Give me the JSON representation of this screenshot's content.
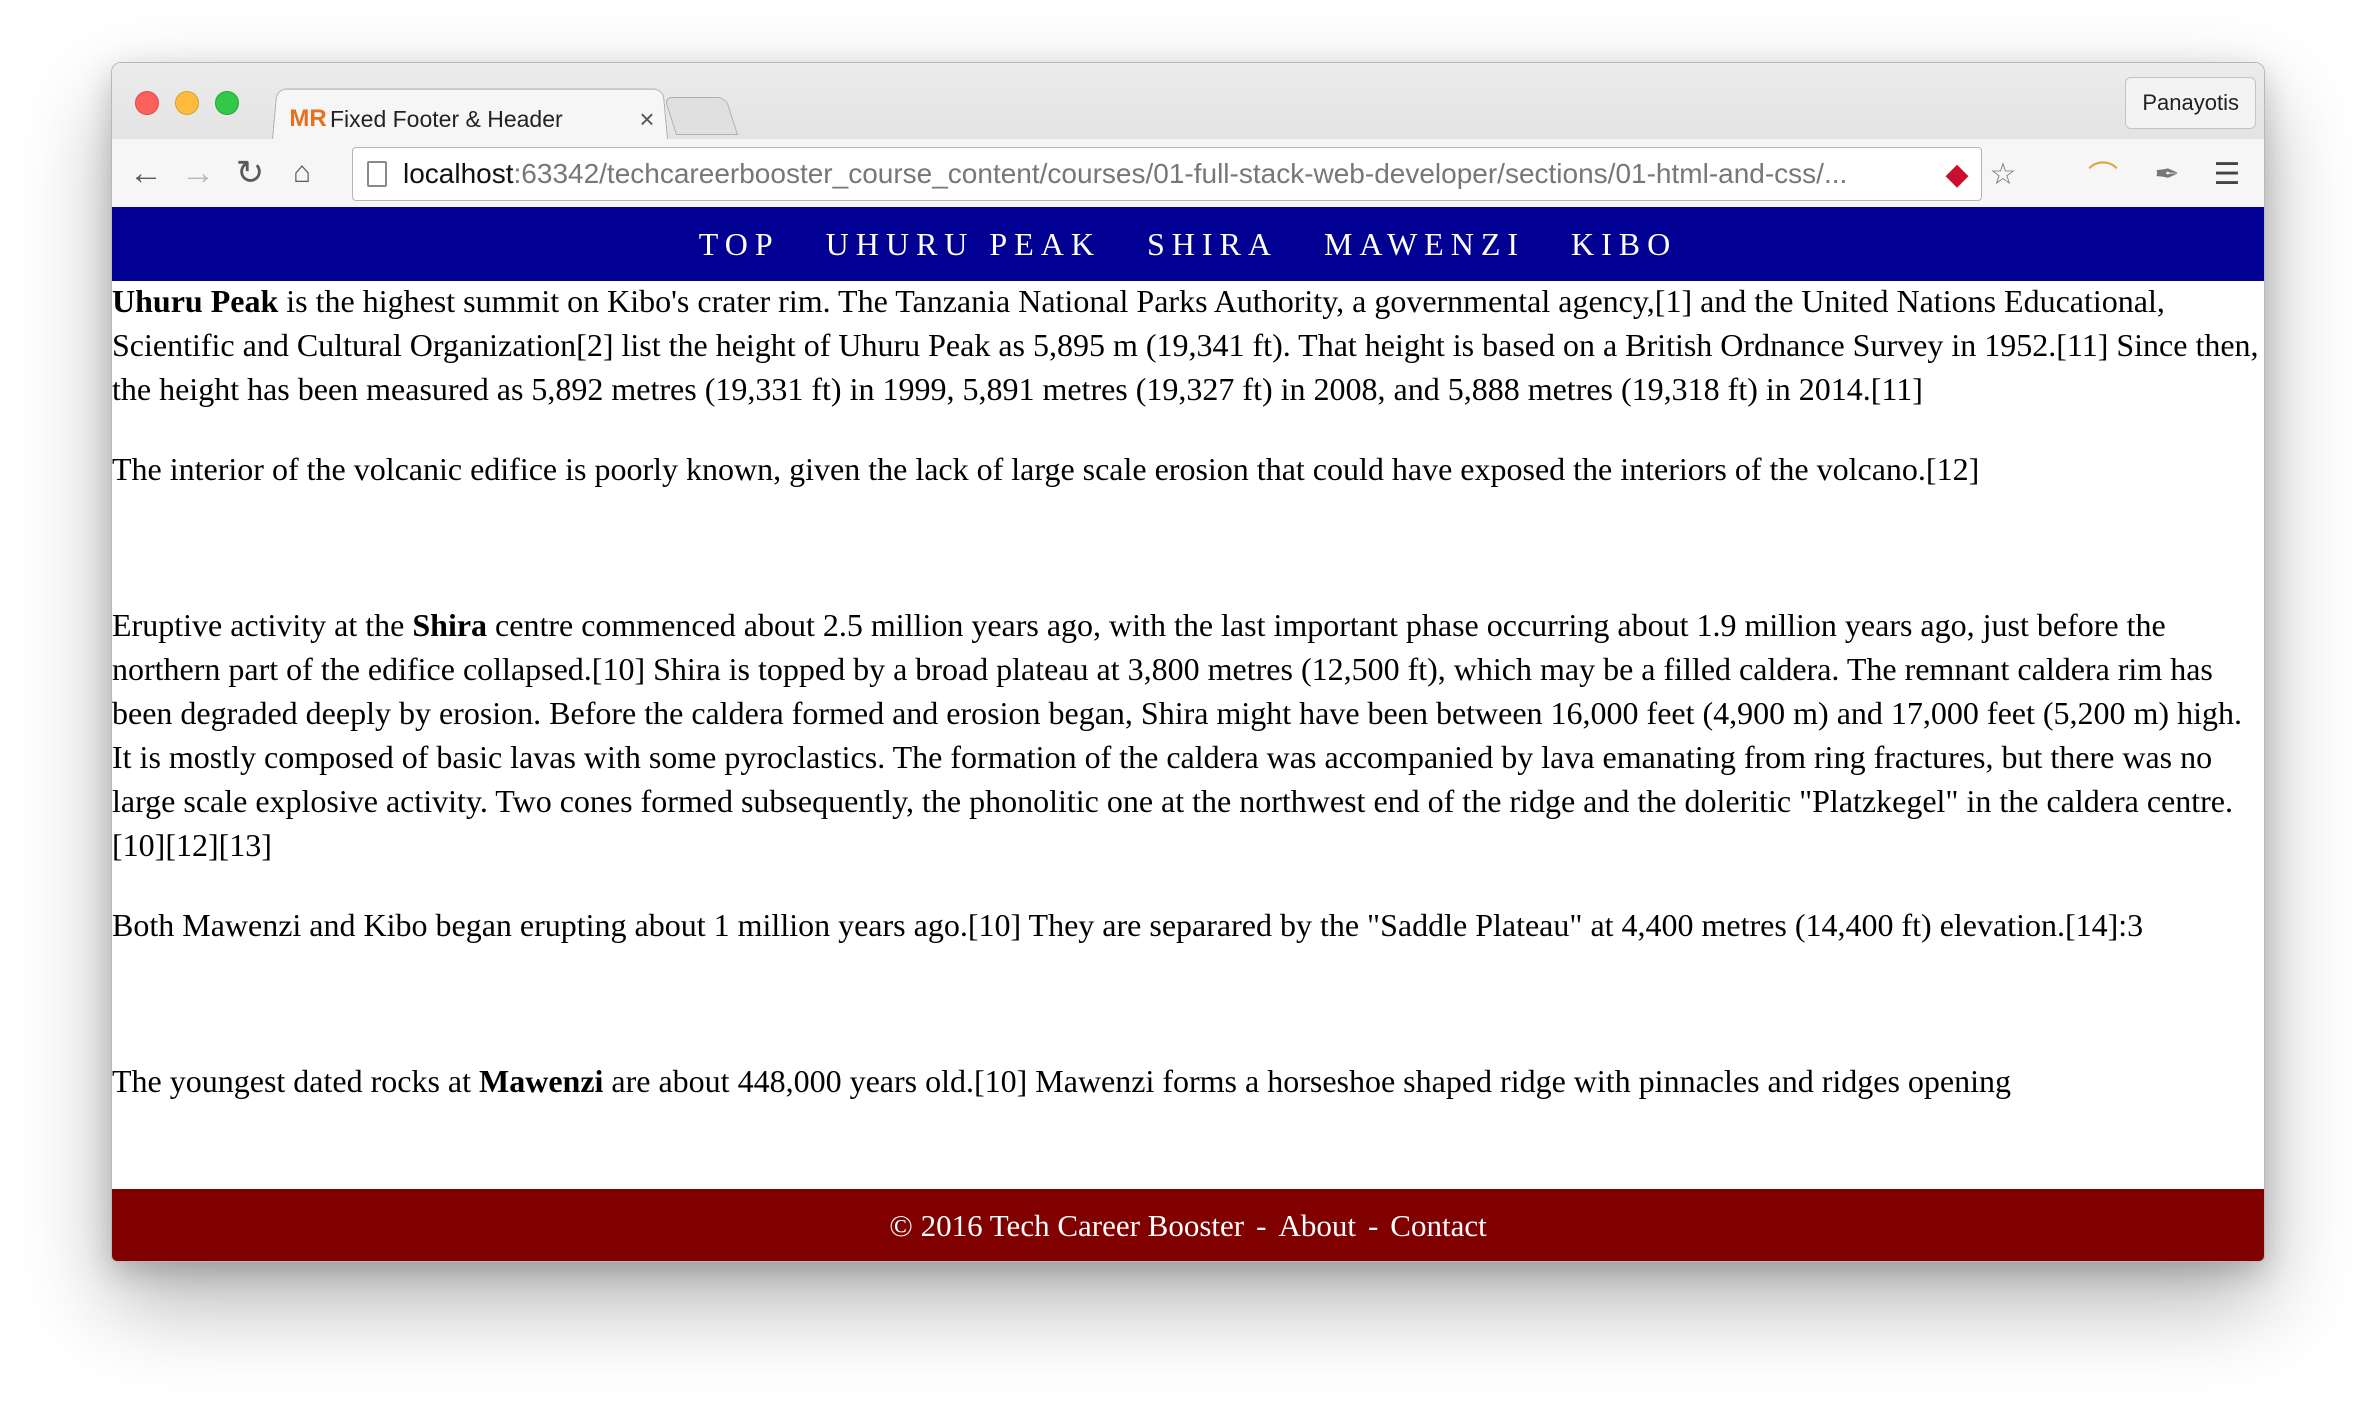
{
  "browser": {
    "tab_title": "Fixed Footer & Header",
    "tab_favicon": "MR",
    "tab_close": "×",
    "profile_name": "Panayotis",
    "url_host": "localhost",
    "url_rest": ":63342/techcareerbooster_course_content/courses/01-full-stack-web-developer/sections/01-html-and-css/...",
    "icons": {
      "back": "back-arrow-icon",
      "forward": "forward-arrow-icon",
      "reload": "reload-icon",
      "home": "home-icon",
      "page": "page-icon",
      "ruby": "ruby-extension-icon",
      "star": "bookmark-star-icon",
      "ext": "extension-icon",
      "tools": "developer-tools-icon",
      "menu": "hamburger-menu-icon"
    }
  },
  "header": {
    "links": [
      "TOP",
      "UHURU PEAK",
      "SHIRA",
      "MAWENZI",
      "KIBO"
    ]
  },
  "content": {
    "p1_bold": "Uhuru Peak",
    "p1_text": " is the highest summit on Kibo's crater rim. The Tanzania National Parks Authority, a governmental agency,[1] and the United Nations Educational, Scientific and Cultural Organization[2] list the height of Uhuru Peak as 5,895 m (19,341 ft). That height is based on a British Ordnance Survey in 1952.[11] Since then, the height has been measured as 5,892 metres (19,331 ft) in 1999, 5,891 metres (19,327 ft) in 2008, and 5,888 metres (19,318 ft) in 2014.[11]",
    "p2_text": "The interior of the volcanic edifice is poorly known, given the lack of large scale erosion that could have exposed the interiors of the volcano.[12]",
    "p3_pre": "Eruptive activity at the ",
    "p3_bold": "Shira",
    "p3_text": " centre commenced about 2.5 million years ago, with the last important phase occurring about 1.9 million years ago, just before the northern part of the edifice collapsed.[10] Shira is topped by a broad plateau at 3,800 metres (12,500 ft), which may be a filled caldera. The remnant caldera rim has been degraded deeply by erosion. Before the caldera formed and erosion began, Shira might have been between 16,000 feet (4,900 m) and 17,000 feet (5,200 m) high. It is mostly composed of basic lavas with some pyroclastics. The formation of the caldera was accompanied by lava emanating from ring fractures, but there was no large scale explosive activity. Two cones formed subsequently, the phonolitic one at the northwest end of the ridge and the doleritic \"Platzkegel\" in the caldera centre.[10][12][13]",
    "p4_text": "Both Mawenzi and Kibo began erupting about 1 million years ago.[10] They are separared by the \"Saddle Plateau\" at 4,400 metres (14,400 ft) elevation.[14]:3",
    "p5_pre": "The youngest dated rocks at ",
    "p5_bold": "Mawenzi",
    "p5_text": " are about 448,000 years old.[10] Mawenzi forms a horseshoe shaped ridge with pinnacles and ridges opening"
  },
  "footer": {
    "copyright": "© 2016 Tech Career Booster",
    "sep1": "-",
    "about": "About",
    "sep2": "-",
    "contact": "Contact"
  }
}
